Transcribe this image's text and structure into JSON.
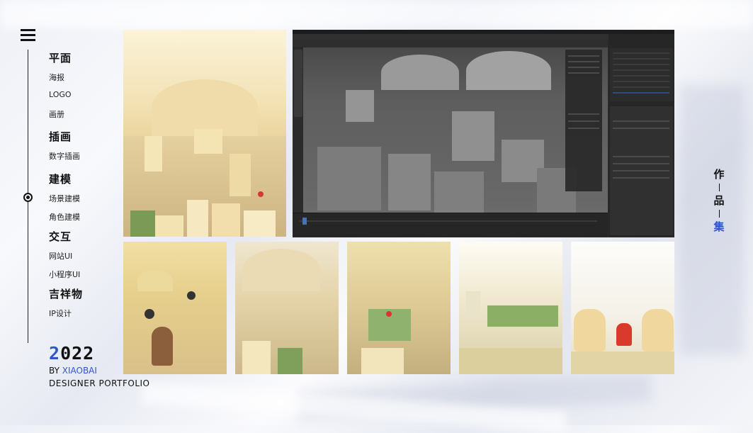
{
  "menu": {
    "categories": [
      {
        "label": "平面",
        "items": [
          "海报",
          "LOGO",
          "画册"
        ]
      },
      {
        "label": "插画",
        "items": [
          "数字插画"
        ]
      },
      {
        "label": "建模",
        "items": [
          "场景建模",
          "角色建模"
        ]
      },
      {
        "label": "交互",
        "items": [
          "网站UI",
          "小程序UI"
        ]
      },
      {
        "label": "吉祥物",
        "items": [
          "IP设计"
        ]
      }
    ]
  },
  "brand": {
    "year_first": "2",
    "year_rest": "022",
    "by_prefix": "BY ",
    "by_name": "XIAOBAI",
    "subtitle": "DESIGNER PORTFOLIO"
  },
  "side_title": {
    "char1": "作",
    "char2": "品",
    "char3": "集"
  },
  "colors": {
    "accent": "#2f55c8",
    "text": "#111111"
  }
}
